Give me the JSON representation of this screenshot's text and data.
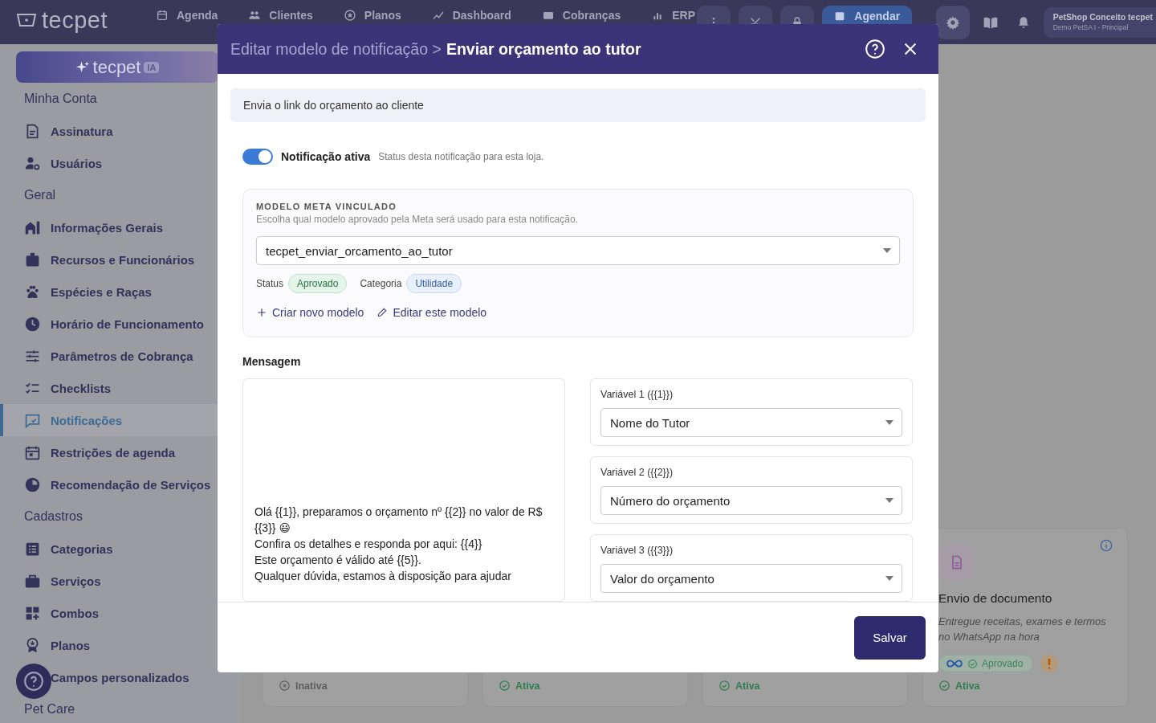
{
  "top_nav": {
    "logo": "tecpet",
    "items": [
      {
        "label": "Agenda"
      },
      {
        "label": "Clientes"
      },
      {
        "label": "Planos"
      },
      {
        "label": "Dashboard"
      },
      {
        "label": "Cobranças"
      },
      {
        "label": "ERP"
      }
    ],
    "schedule_button": "Agendar",
    "account": {
      "name": "PetShop Conceito tecpet",
      "store": "Demo PetSA I - Principal"
    }
  },
  "sidebar": {
    "banner": {
      "brand": "tecpet",
      "badge": "IA"
    },
    "sections": [
      {
        "title": "Minha Conta",
        "items": [
          {
            "label": "Assinatura",
            "selected": false
          },
          {
            "label": "Usuários",
            "selected": false
          }
        ]
      },
      {
        "title": "Geral",
        "items": [
          {
            "label": "Informações Gerais",
            "selected": false
          },
          {
            "label": "Recursos e Funcionários",
            "selected": false
          },
          {
            "label": "Espécies e Raças",
            "selected": false
          },
          {
            "label": "Horário de Funcionamento",
            "selected": false
          },
          {
            "label": "Parâmetros de Cobrança",
            "selected": false
          },
          {
            "label": "Checklists",
            "selected": false
          },
          {
            "label": "Notificações",
            "selected": true
          },
          {
            "label": "Restrições de agenda",
            "selected": false
          },
          {
            "label": "Recomendação de Serviços",
            "selected": false
          }
        ]
      },
      {
        "title": "Cadastros",
        "items": [
          {
            "label": "Categorias",
            "selected": false
          },
          {
            "label": "Serviços",
            "selected": false
          },
          {
            "label": "Combos",
            "selected": false
          },
          {
            "label": "Planos",
            "selected": false
          },
          {
            "label": "Campos personalizados",
            "selected": false
          }
        ]
      },
      {
        "title": "Pet Care"
      }
    ]
  },
  "cards": [
    {
      "status": "Inativa",
      "active": false
    },
    {
      "status": "Ativa",
      "active": true
    },
    {
      "status": "Ativa",
      "active": true
    },
    {
      "title": "Envio de documento",
      "description": "Entregue receitas, exames e termos no WhatsApp na hora",
      "badge": "Aprovado",
      "status": "Ativa",
      "active": true
    }
  ],
  "modal": {
    "breadcrumb": "Editar modelo de notificação >",
    "title": "Enviar orçamento ao tutor",
    "description": "Envia o link do orçamento ao cliente",
    "toggle": {
      "label": "Notificação ativa",
      "hint": "Status desta notificação para esta loja.",
      "on": true
    },
    "template": {
      "heading": "MODELO META VINCULADO",
      "subheading": "Escolha qual modelo aprovado pela Meta será usado para esta notificação.",
      "value": "tecpet_enviar_orcamento_ao_tutor",
      "status_label": "Status",
      "status": "Aprovado",
      "category_label": "Categoria",
      "category": "Utilidade",
      "links": [
        {
          "kind": "create",
          "label": "Criar novo modelo"
        },
        {
          "kind": "edit",
          "label": "Editar este modelo"
        }
      ]
    },
    "message_label": "Mensagem",
    "message_lines": [
      "Olá {{1}}, preparamos o orçamento nº {{2}} no valor de R$ {{3}} 😃",
      "Confira os detalhes e responda por aqui: {{4}}",
      "Este orçamento é válido até {{5}}.",
      "Qualquer dúvida, estamos à disposição para ajudar"
    ],
    "variables": [
      {
        "label": "Variável 1 ({{1}})",
        "value": "Nome do Tutor"
      },
      {
        "label": "Variável 2 ({{2}})",
        "value": "Número do orçamento"
      },
      {
        "label": "Variável 3 ({{3}})",
        "value": "Valor do orçamento"
      }
    ],
    "save_button": "Salvar"
  }
}
